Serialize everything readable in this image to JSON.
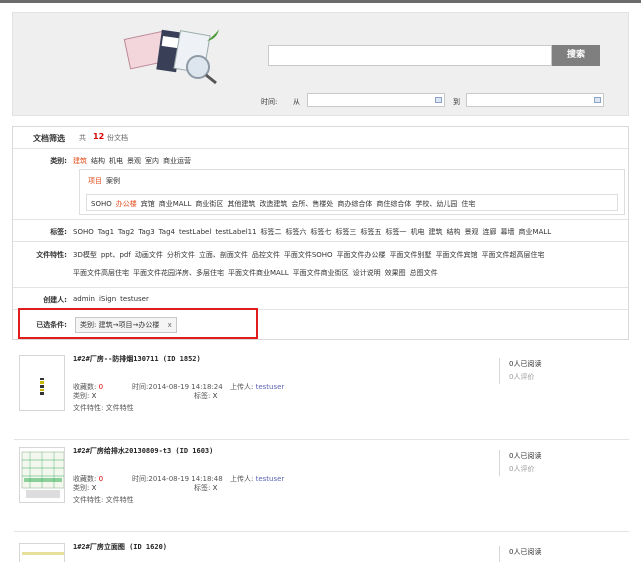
{
  "search": {
    "button_label": "搜索",
    "placeholder": ""
  },
  "time": {
    "label": "时间:",
    "from": "从",
    "to": "到"
  },
  "filter": {
    "title": "文档筛选",
    "total_prefix": "共",
    "total_count": "12",
    "total_suffix": "份文档",
    "category": {
      "label": "类别:",
      "items": [
        "建筑",
        "结构",
        "机电",
        "景观",
        "室内",
        "商业运营"
      ],
      "sub1": [
        "项目",
        "案例"
      ],
      "sub2": [
        "SOHO",
        "办公楼",
        "宾馆",
        "商业MALL",
        "商业街区",
        "其他建筑",
        "改造建筑",
        "会所、售楼处",
        "商办综合体",
        "商住综合体",
        "学校、幼儿园",
        "住宅"
      ]
    },
    "tags": {
      "label": "标签:",
      "items": [
        "SOHO",
        "Tag1",
        "Tag2",
        "Tag3",
        "Tag4",
        "testLabel",
        "testLabel11",
        "标签二",
        "标签六",
        "标签七",
        "标签三",
        "标签五",
        "标签一",
        "机电",
        "建筑",
        "结构",
        "景观",
        "连廊",
        "幕墙",
        "商业MALL"
      ]
    },
    "features": {
      "label": "文件特性:",
      "line1": [
        "3D模型",
        "ppt、pdf",
        "动画文件",
        "分析文件",
        "立面、剖面文件",
        "品控文件",
        "平面文件SOHO",
        "平面文件办公楼",
        "平面文件别墅",
        "平面文件宾馆",
        "平面文件超高层住宅"
      ],
      "line2": [
        "平面文件高层住宅",
        "平面文件花园洋房、多层住宅",
        "平面文件商业MALL",
        "平面文件商业街区",
        "设计说明",
        "效果图",
        "总图文件"
      ]
    },
    "creator": {
      "label": "创建人:",
      "items": [
        "admin",
        "iSign",
        "testuser"
      ]
    },
    "selected": {
      "label": "已选条件:",
      "tag": "类别: 建筑→项目→办公楼",
      "remove": "x"
    }
  },
  "results": [
    {
      "title": "1#2#厂房--防排烟130711 (ID 1852)",
      "fav_label": "收藏数:",
      "fav": "0",
      "time_label": "时间:",
      "time": "2014-08-19 14:18:24",
      "uploader_label": "上传人:",
      "uploader": "testuser",
      "cat_label": "类别:",
      "cat": "X",
      "tag_label": "标签:",
      "tag": "X",
      "feat_label": "文件特性:",
      "feat": "文件特性",
      "reads": "0人已阅读",
      "reviews": "0人评价"
    },
    {
      "title": "1#2#厂房给排水20130809-t3 (ID 1603)",
      "fav_label": "收藏数:",
      "fav": "0",
      "time_label": "时间:",
      "time": "2014-08-19 14:18:48",
      "uploader_label": "上传人:",
      "uploader": "testuser",
      "cat_label": "类别:",
      "cat": "X",
      "tag_label": "标签:",
      "tag": "X",
      "feat_label": "文件特性:",
      "feat": "文件特性",
      "reads": "0人已阅读",
      "reviews": "0人评价"
    },
    {
      "title": "1#2#厂房立面图 (ID 1620)",
      "reads": "0人已阅读"
    }
  ]
}
